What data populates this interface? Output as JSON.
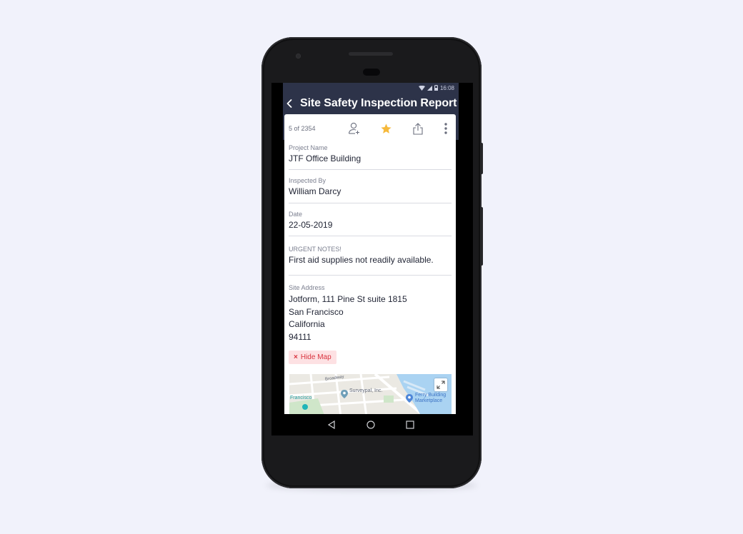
{
  "status_bar": {
    "time": "16:08"
  },
  "app_bar": {
    "title": "Site Safety Inspection Report",
    "back_icon": "chevron-left-icon"
  },
  "toolbar": {
    "counter": "5 of 2354",
    "icons": [
      "assign-user-icon",
      "star-icon",
      "share-icon",
      "more-vertical-icon"
    ],
    "star_color": "#f6b93b"
  },
  "fields": {
    "project_name": {
      "label": "Project Name",
      "value": "JTF Office Building"
    },
    "inspected_by": {
      "label": "Inspected By",
      "value": "William Darcy"
    },
    "date": {
      "label": "Date",
      "value": "22-05-2019"
    },
    "urgent_notes": {
      "label": "URGENT NOTES!",
      "value": "First aid supplies not readily available."
    },
    "site_address": {
      "label": "Site Address",
      "lines": [
        "Jotform, 111 Pine St suite 1815",
        "San Francisco",
        "California",
        "94111"
      ]
    }
  },
  "hide_map_button": {
    "icon": "×",
    "label": "Hide Map"
  },
  "map": {
    "labels": {
      "broadway": "Broadway",
      "surveypal": "Surveypal, Inc.",
      "ferry_line1": "Ferry Building",
      "ferry_line2": "Marketplace",
      "francisco": "Francisco"
    }
  },
  "colors": {
    "app_bar": "#2d3349",
    "accent_red": "#d9343f",
    "background": "#f1f2fb"
  }
}
